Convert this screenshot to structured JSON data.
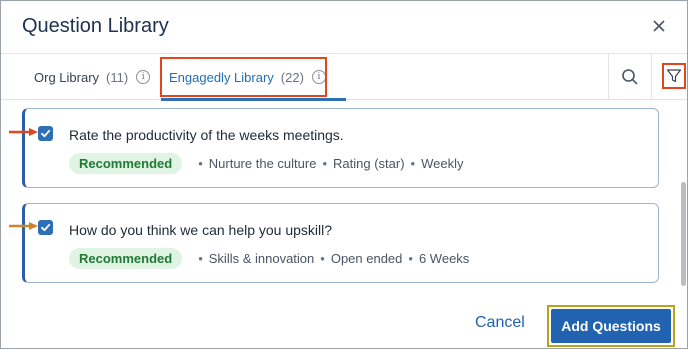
{
  "dialog": {
    "title": "Question Library",
    "close_icon": "close-icon"
  },
  "tabs": [
    {
      "label": "Org Library",
      "count": "(11)",
      "info": "i",
      "active": false
    },
    {
      "label": "Engagedly Library",
      "count": "(22)",
      "info": "i",
      "active": true
    }
  ],
  "toolbar": {
    "search_icon": "search-icon",
    "filter_icon": "filter-icon"
  },
  "questions": [
    {
      "checked": true,
      "text": "Rate the productivity of the weeks meetings.",
      "badge": "Recommended",
      "tags": [
        "Nurture the culture",
        "Rating (star)",
        "Weekly"
      ],
      "bullet": "•"
    },
    {
      "checked": true,
      "text": "How do you think we can help you upskill?",
      "badge": "Recommended",
      "tags": [
        "Skills & innovation",
        "Open ended",
        "6 Weeks"
      ],
      "bullet": "•"
    }
  ],
  "footer": {
    "cancel_label": "Cancel",
    "add_label": "Add Questions"
  },
  "colors": {
    "accent": "#2163b0",
    "highlight": "#e2461f",
    "badge_bg": "#dff4e2",
    "badge_text": "#1f7a34"
  }
}
